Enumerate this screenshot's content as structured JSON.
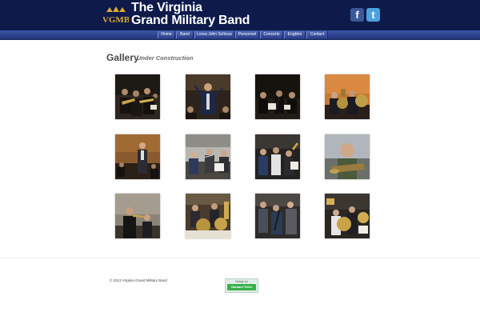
{
  "header": {
    "logo_text": "VGMB",
    "title_line1": "The Virginia",
    "title_line2": "Grand Military Band",
    "social": [
      {
        "name": "facebook-icon",
        "glyph": "f"
      },
      {
        "name": "twitter-icon",
        "glyph": "t"
      }
    ]
  },
  "nav": {
    "items": [
      {
        "label": "Home"
      },
      {
        "label": "Band"
      },
      {
        "label": "Lorea John Schloss"
      },
      {
        "label": "Personnel"
      },
      {
        "label": "Concerts"
      },
      {
        "label": "Engbtre"
      },
      {
        "label": "Contact"
      }
    ]
  },
  "gallery": {
    "title": "Gallery",
    "subtitle": "Under Construction",
    "photos": [
      {
        "name": "photo-brass-section"
      },
      {
        "name": "photo-conductor"
      },
      {
        "name": "photo-woodwinds"
      },
      {
        "name": "photo-tuba-players"
      },
      {
        "name": "photo-standing-musician"
      },
      {
        "name": "photo-flute-section"
      },
      {
        "name": "photo-clarinets"
      },
      {
        "name": "photo-bald-musician"
      },
      {
        "name": "photo-trumpet-player"
      },
      {
        "name": "photo-horn-section"
      },
      {
        "name": "photo-seated-musicians"
      },
      {
        "name": "photo-sousaphones"
      }
    ]
  },
  "footer": {
    "copyright": "© 2013 Virginia Grand Military Band",
    "badge_top": "Design by",
    "badge_label": "Garland Teller"
  },
  "colors": {
    "header_bg": "#0d1a4a",
    "nav_bg": "#2b3f88",
    "logo_gold": "#d8a832"
  }
}
